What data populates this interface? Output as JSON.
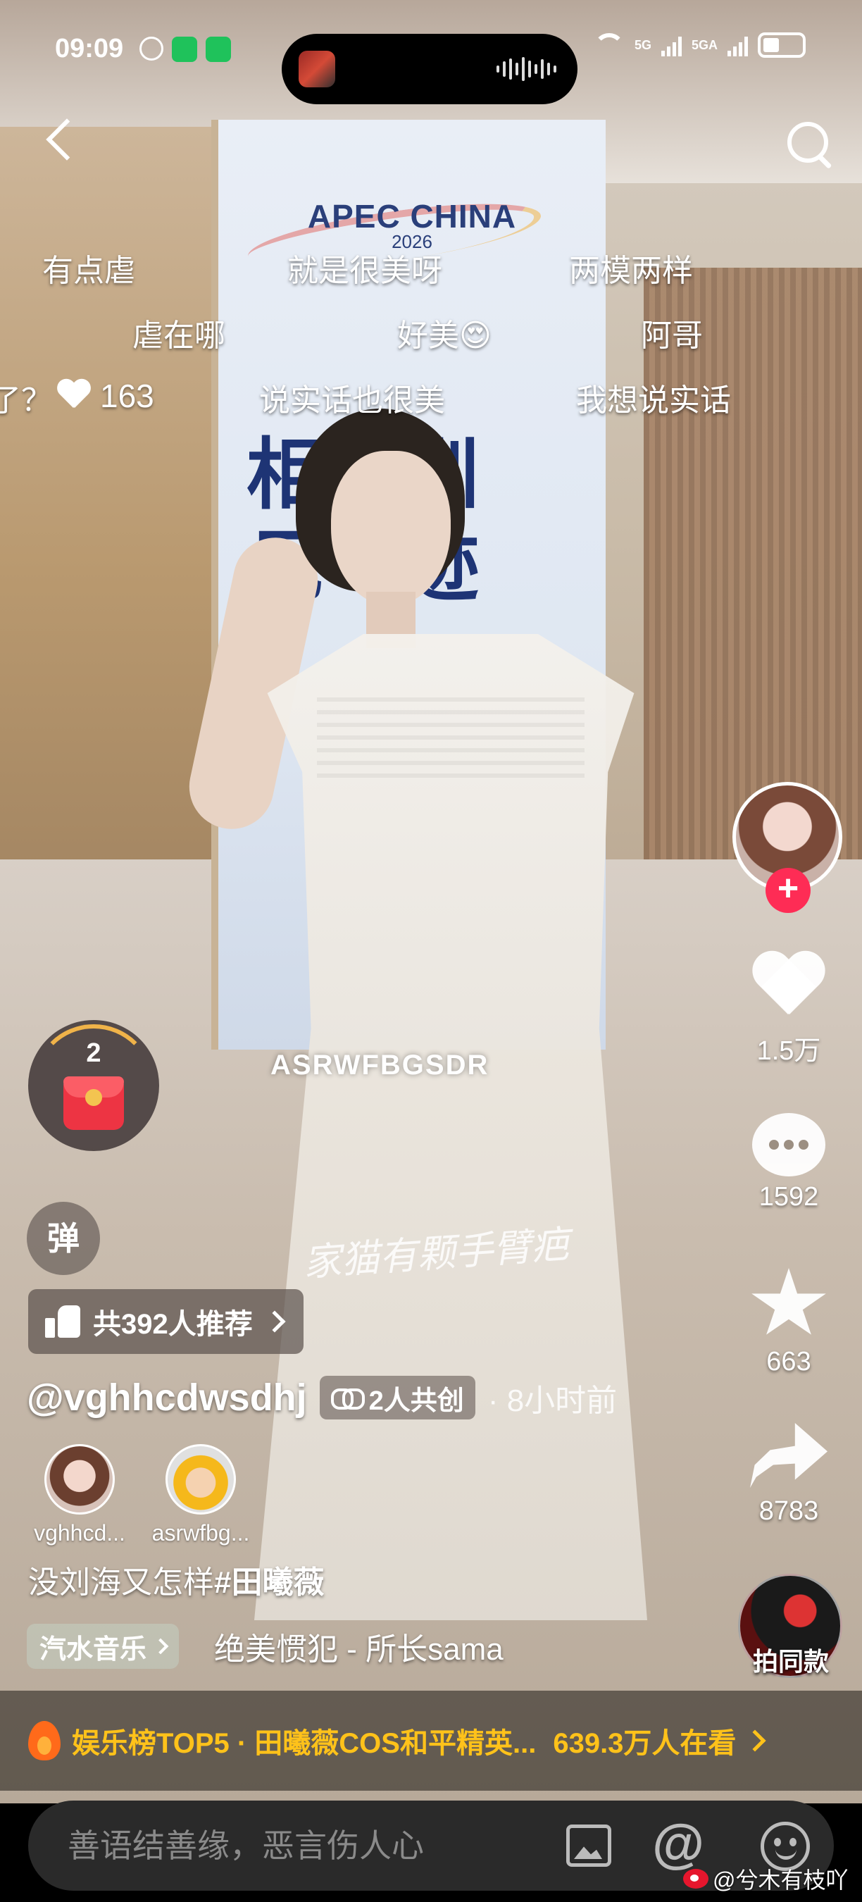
{
  "status_bar": {
    "time": "09:09",
    "net1": "5G",
    "net2": "5GA"
  },
  "banner": {
    "title": "APEC CHINA",
    "year": "2026",
    "cjk_text": "相 圳 见 迹"
  },
  "danmaku": [
    {
      "text": "有点虐"
    },
    {
      "text": "就是很美呀"
    },
    {
      "text": "两模两样"
    },
    {
      "text": "虐在哪"
    },
    {
      "text": "好美😍"
    },
    {
      "text": "阿哥"
    },
    {
      "text": "说实话也很美"
    },
    {
      "text": "我想说实话"
    },
    {
      "text": "了？"
    }
  ],
  "danmaku_like_count": "163",
  "video_watermark": "ASRWFBGSDR",
  "handwritten_overlay": "家猫有颗手臂疤",
  "right_rail": {
    "like_count": "1.5万",
    "comment_count": "1592",
    "favorite_count": "663",
    "share_count": "8783",
    "same_style_label": "拍同款"
  },
  "red_packet": {
    "count": "2"
  },
  "danmu_toggle": "弹",
  "recommend": {
    "label": "共392人推荐"
  },
  "author": {
    "username": "@vghhcdwsdhj",
    "cocreate_label": "2人共创",
    "time_ago": "· 8小时前"
  },
  "co_creators": [
    {
      "name": "vghhcd..."
    },
    {
      "name": "asrwfbg..."
    }
  ],
  "caption": {
    "text": "没刘海又怎样",
    "hashtag": "#田曦薇"
  },
  "music": {
    "tag": "汽水音乐",
    "title": "绝美惯犯 - 所长sama"
  },
  "hotbar": {
    "text": "娱乐榜TOP5 · 田曦薇COS和平精英...",
    "viewers": "639.3万人在看"
  },
  "comment_input": {
    "placeholder": "善语结善缘，恶言伤人心"
  },
  "source_mark": "@兮木有枝吖",
  "colors": {
    "follow": "#fe2c55",
    "hot": "#ffc21a"
  }
}
